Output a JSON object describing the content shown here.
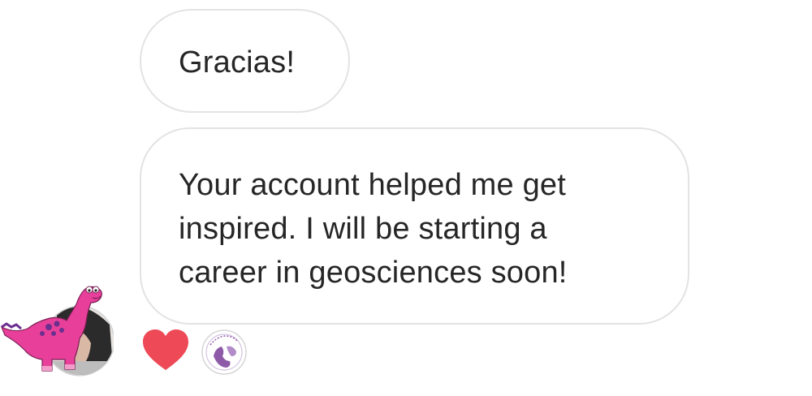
{
  "thread": {
    "messages": [
      {
        "lines": [
          "Gracias!"
        ]
      },
      {
        "lines": [
          "Your account helped me get",
          "inspired. I will be starting a",
          "career in geosciences soon!"
        ],
        "reactions": [
          {
            "icon": "heart-icon",
            "color": "#ed4956"
          },
          {
            "icon": "reactor-avatar"
          }
        ]
      }
    ],
    "sender_avatar": {
      "icon": "pink-dinosaur-avatar",
      "accent": "#e8409a"
    }
  },
  "colors": {
    "bubble_border": "#e3e3e3",
    "text": "#262626",
    "heart": "#ed4956",
    "dinosaur": "#e8409a",
    "dinosaur_spots": "#6b2f8f",
    "reactor_logo": "#8e5aa8"
  }
}
